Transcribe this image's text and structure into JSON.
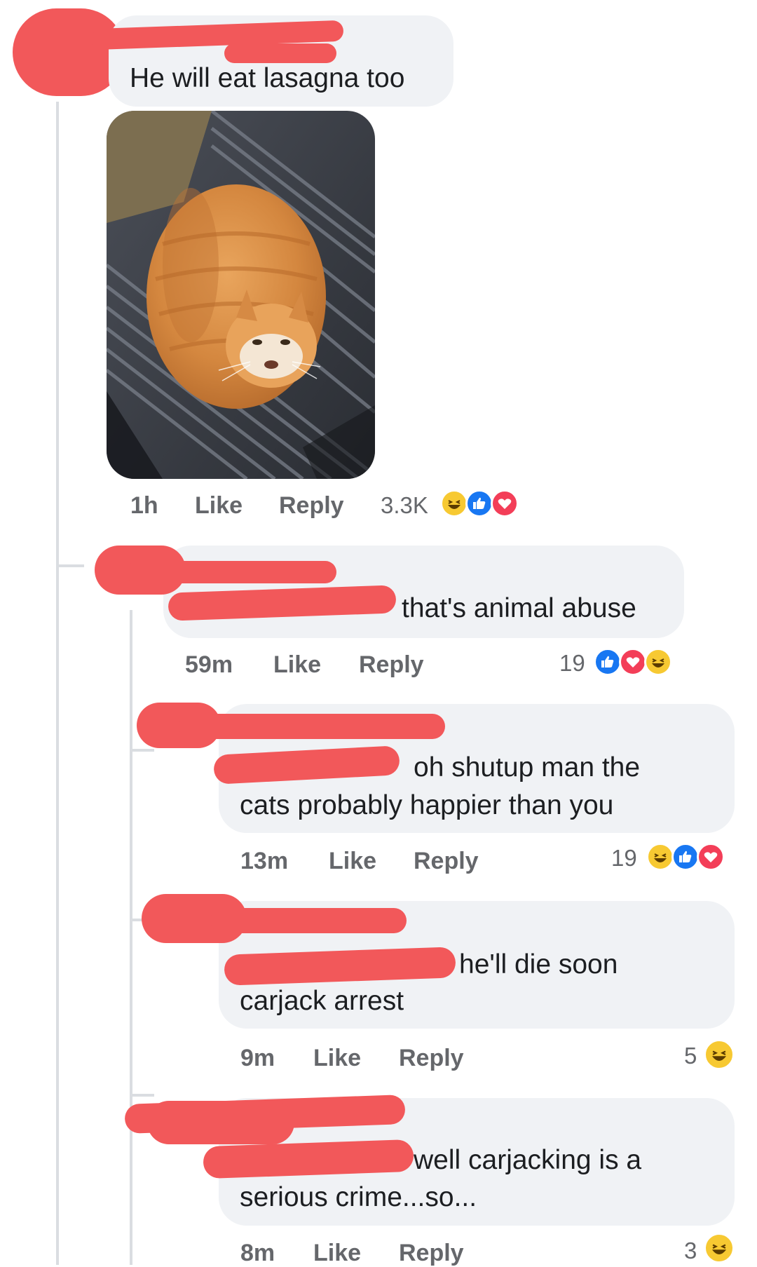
{
  "comments": [
    {
      "text": "He will eat lasagna too",
      "time": "1h",
      "like_label": "Like",
      "reply_label": "Reply",
      "reaction_count": "3.3K",
      "reactions": [
        "haha",
        "like",
        "love"
      ]
    },
    {
      "text": "that's animal abuse",
      "time": "59m",
      "like_label": "Like",
      "reply_label": "Reply",
      "reaction_count": "19",
      "reactions": [
        "like",
        "love",
        "haha"
      ]
    },
    {
      "text_line1": "oh shutup man the",
      "text_line2": "cats probably happier than you",
      "time": "13m",
      "like_label": "Like",
      "reply_label": "Reply",
      "reaction_count": "19",
      "reactions": [
        "haha",
        "like",
        "love"
      ]
    },
    {
      "text_line1": "he'll die soon",
      "text_line2": "carjack arrest",
      "time": "9m",
      "like_label": "Like",
      "reply_label": "Reply",
      "reaction_count": "5",
      "reactions": [
        "haha"
      ]
    },
    {
      "text_line1": "well carjacking is a",
      "text_line2": "serious crime...so...",
      "time": "8m",
      "like_label": "Like",
      "reply_label": "Reply",
      "reaction_count": "3",
      "reactions": [
        "haha"
      ]
    }
  ],
  "colors": {
    "bubble": "#f0f2f5",
    "redaction": "#f2585a",
    "meta_text": "#65676b",
    "like_blue": "#1877f2",
    "love_red": "#f33e58",
    "haha_yellow": "#f7c932"
  },
  "icons": [
    "haha-reaction-icon",
    "like-reaction-icon",
    "love-reaction-icon"
  ]
}
